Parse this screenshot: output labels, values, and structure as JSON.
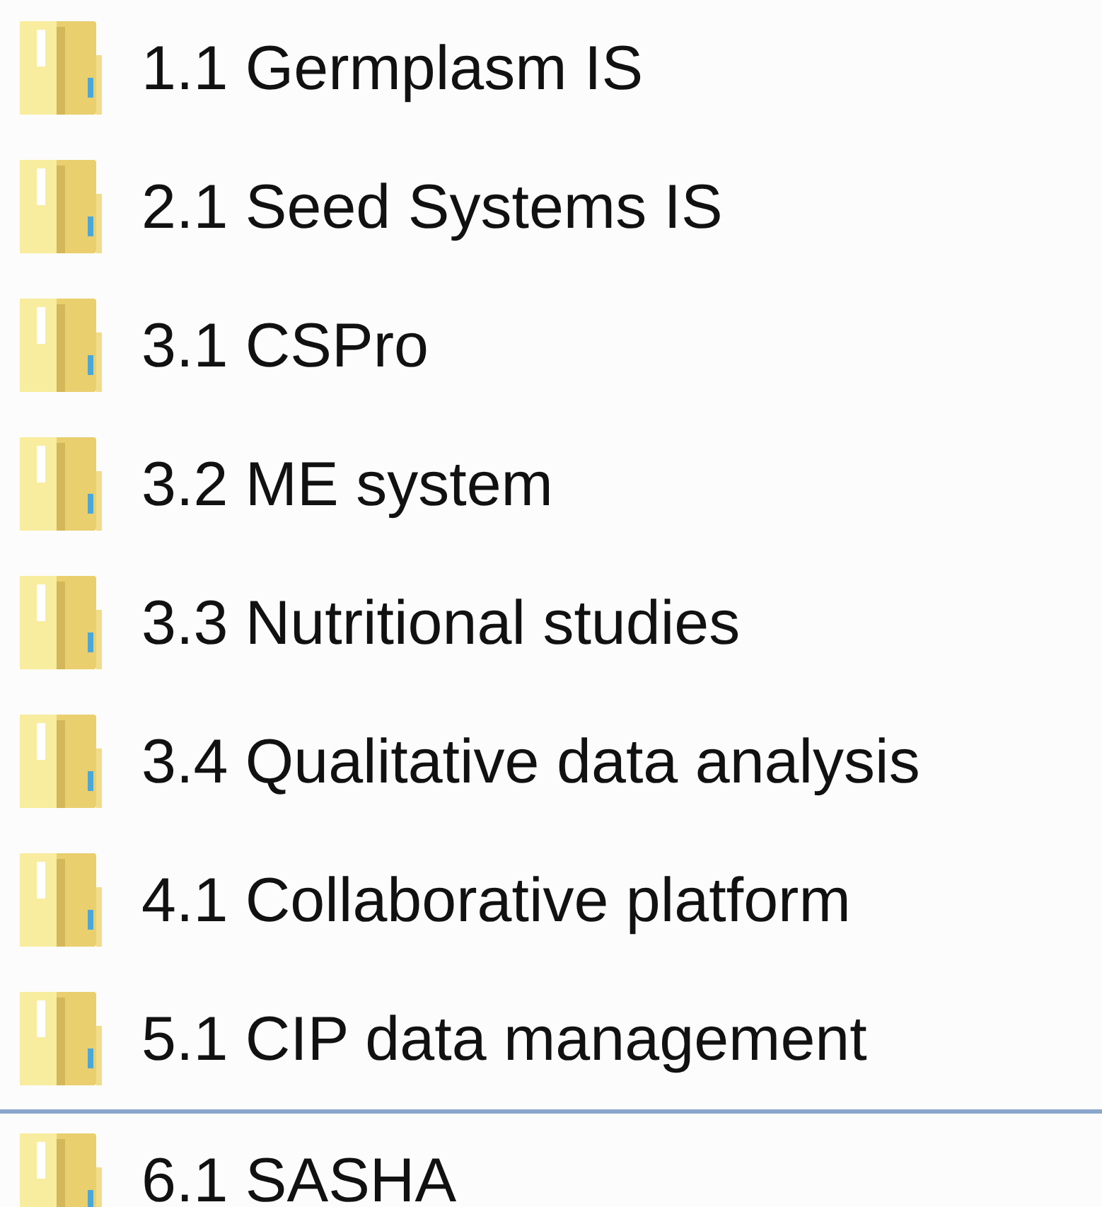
{
  "folders": [
    {
      "name": "1.1 Germplasm IS"
    },
    {
      "name": "2.1 Seed Systems IS"
    },
    {
      "name": "3.1 CSPro"
    },
    {
      "name": "3.2 ME system"
    },
    {
      "name": "3.3 Nutritional studies"
    },
    {
      "name": "3.4 Qualitative data analysis"
    },
    {
      "name": "4.1 Collaborative platform"
    },
    {
      "name": "5.1 CIP data management"
    },
    {
      "name": "6.1 SASHA"
    }
  ]
}
